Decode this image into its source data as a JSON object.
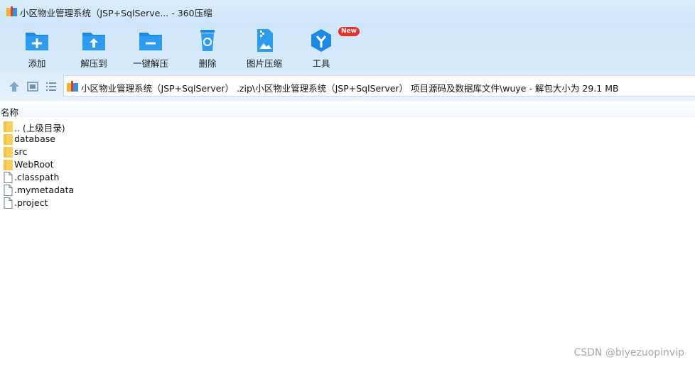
{
  "window": {
    "title": "小区物业管理系统（JSP+SqlServe... - 360压缩"
  },
  "toolbar": {
    "items": [
      {
        "label": "添加",
        "icon": "add-folder-icon"
      },
      {
        "label": "解压到",
        "icon": "extract-to-folder-icon"
      },
      {
        "label": "一键解压",
        "icon": "one-click-extract-folder-icon"
      },
      {
        "label": "删除",
        "icon": "recycle-bin-icon"
      },
      {
        "label": "图片压缩",
        "icon": "image-compress-icon"
      },
      {
        "label": "工具",
        "icon": "tools-icon",
        "badge": "New"
      }
    ]
  },
  "navbar": {
    "path": "小区物业管理系统（JSP+SqlServer） .zip\\小区物业管理系统（JSP+SqlServer） 项目源码及数据库文件\\wuye - 解包大小为 29.1 MB"
  },
  "list": {
    "header_name": "名称",
    "items": [
      {
        "name": ".. (上级目录)",
        "type": "folder"
      },
      {
        "name": "database",
        "type": "folder"
      },
      {
        "name": "src",
        "type": "folder"
      },
      {
        "name": "WebRoot",
        "type": "folder"
      },
      {
        "name": ".classpath",
        "type": "file"
      },
      {
        "name": ".mymetadata",
        "type": "file"
      },
      {
        "name": ".project",
        "type": "file"
      }
    ]
  },
  "watermark": "CSDN @biyezuopinvip",
  "colors": {
    "accent": "#1e88e5",
    "badge": "#e8302c",
    "folder": "#f7cf5a"
  }
}
